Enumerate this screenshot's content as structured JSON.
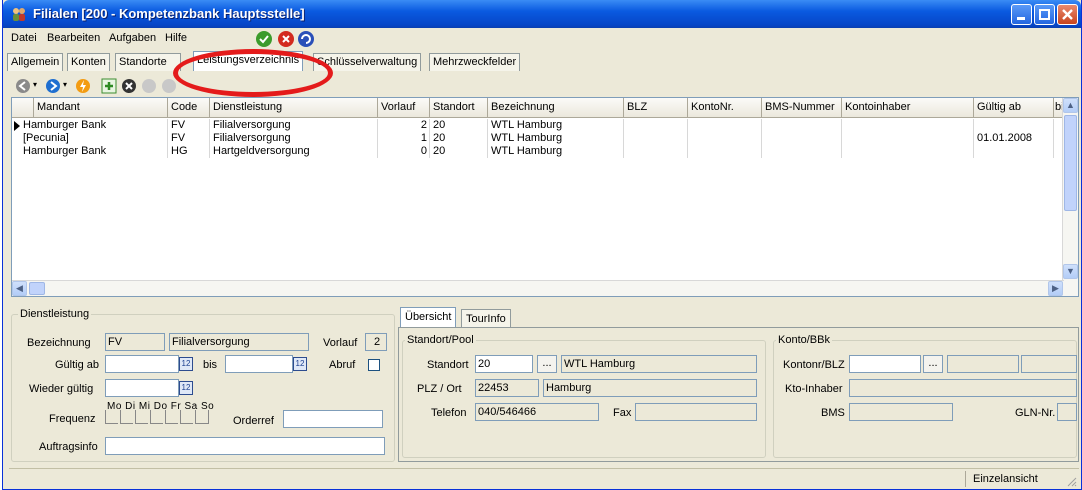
{
  "window": {
    "title": "Filialen [200 - Kompetenzbank Hauptsstelle]"
  },
  "menu": [
    {
      "label": "Datei"
    },
    {
      "label": "Bearbeiten"
    },
    {
      "label": "Aufgaben"
    },
    {
      "label": "Hilfe"
    }
  ],
  "tabs": [
    {
      "label": "Allgemein"
    },
    {
      "label": "Konten"
    },
    {
      "label": "Standorte"
    },
    {
      "label": "Leistungsverzeichnis"
    },
    {
      "label": "Schlüsselverwaltung"
    },
    {
      "label": "Mehrzweckfelder"
    }
  ],
  "grid": {
    "columns": [
      "Mandant",
      "Code",
      "Dienstleistung",
      "Vorlauf",
      "Standort",
      "Bezeichnung",
      "BLZ",
      "KontoNr.",
      "BMS-Nummer",
      "Kontoinhaber",
      "Gültig ab",
      "bi"
    ],
    "rows": [
      [
        "Hamburger Bank",
        "FV",
        "Filialversorgung",
        "2",
        "20",
        "WTL Hamburg",
        "",
        "",
        "",
        "",
        "",
        ""
      ],
      [
        "[Pecunia]",
        "FV",
        "Filialversorgung",
        "1",
        "20",
        "WTL Hamburg",
        "",
        "",
        "",
        "",
        "01.01.2008",
        ""
      ],
      [
        "Hamburger Bank",
        "HG",
        "Hartgeldversorgung",
        "0",
        "20",
        "WTL Hamburg",
        "",
        "",
        "",
        "",
        "",
        ""
      ]
    ]
  },
  "dienstleistung": {
    "group_label": "Dienstleistung",
    "bezeichnung_label": "Bezeichnung",
    "bezeichnung_code": "FV",
    "bezeichnung_name": "Filialversorgung",
    "vorlauf_label": "Vorlauf",
    "vorlauf_value": "2",
    "gueltig_ab_label": "Gültig ab",
    "gueltig_ab_value": "",
    "bis_label": "bis",
    "bis_value": "",
    "abruf_label": "Abruf",
    "wieder_gueltig_label": "Wieder gültig",
    "wieder_gueltig_value": "",
    "frequenz_label": "Frequenz",
    "days": "Mo Di  Mi  Do  Fr  Sa  So",
    "orderref_label": "Orderref",
    "orderref_value": "",
    "auftragsinfo_label": "Auftragsinfo",
    "auftragsinfo_value": ""
  },
  "subtabs": [
    {
      "label": "Übersicht"
    },
    {
      "label": "TourInfo"
    }
  ],
  "standort": {
    "group_label": "Standort/Pool",
    "standort_label": "Standort",
    "standort_value": "20",
    "standort_name": "WTL Hamburg",
    "plz_label": "PLZ / Ort",
    "plz_value": "22453",
    "ort_value": "Hamburg",
    "telefon_label": "Telefon",
    "telefon_value": "040/546466",
    "fax_label": "Fax",
    "fax_value": ""
  },
  "konto": {
    "group_label": "Konto/BBk",
    "kontonr_label": "Kontonr/BLZ",
    "kontonr_value": "",
    "inhaber_label": "Kto-Inhaber",
    "inhaber_value": "",
    "bms_label": "BMS",
    "bms_value": "",
    "gln_label": "GLN-Nr.",
    "gln_value": ""
  },
  "status": {
    "mode": "Einzelansicht"
  },
  "colors": {
    "title_bar": "#0a5ae0",
    "highlight": "#e41b1b",
    "panel": "#ece9d8"
  }
}
